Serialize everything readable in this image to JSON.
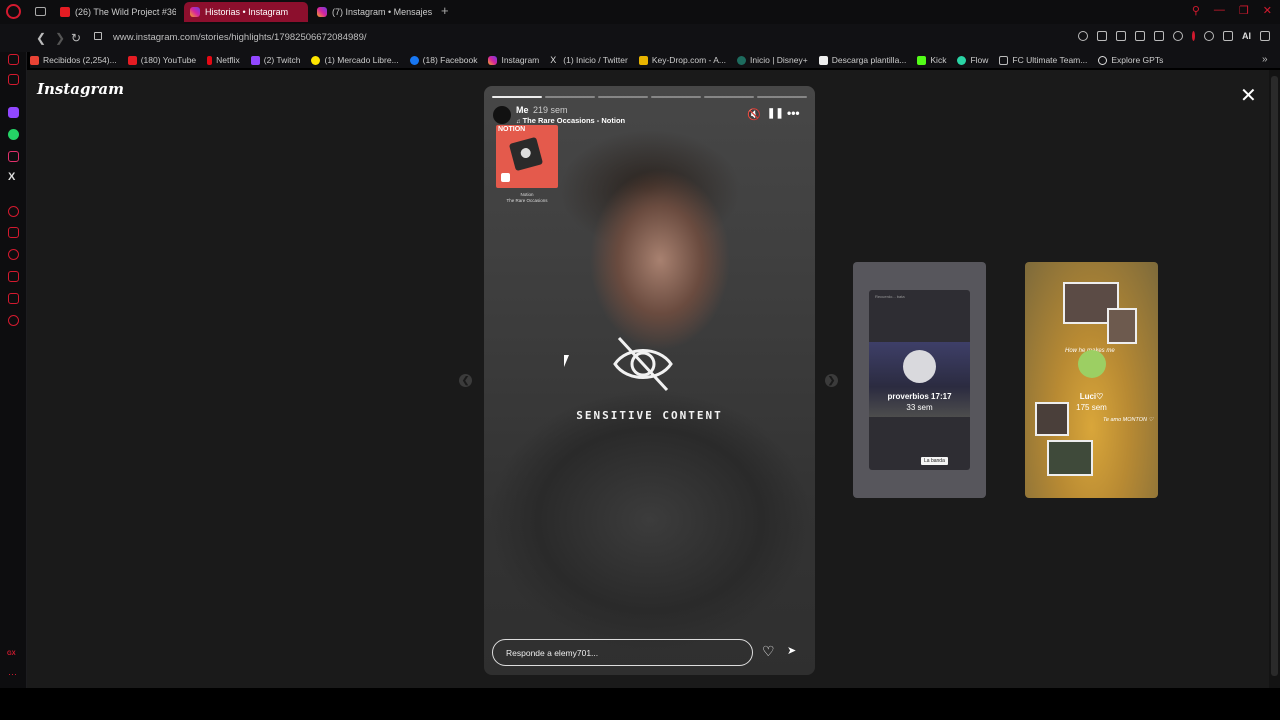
{
  "browser": {
    "tabs": [
      {
        "title": "(26) The Wild Project #36"
      },
      {
        "title": "Historias • Instagram"
      },
      {
        "title": "(7) Instagram • Mensajes"
      }
    ],
    "url": "www.instagram.com/stories/highlights/17982506672084989/",
    "ai_label": "AI",
    "bookmarks": [
      {
        "label": "Recibidos (2,254)..."
      },
      {
        "label": "(180) YouTube"
      },
      {
        "label": "Netflix"
      },
      {
        "label": "(2) Twitch"
      },
      {
        "label": "(1) Mercado Libre..."
      },
      {
        "label": "(18) Facebook"
      },
      {
        "label": "Instagram"
      },
      {
        "label": "(1) Inicio / Twitter"
      },
      {
        "label": "Key-Drop.com - A..."
      },
      {
        "label": "Inicio | Disney+"
      },
      {
        "label": "Descarga plantilla..."
      },
      {
        "label": "Kick"
      },
      {
        "label": "Flow"
      },
      {
        "label": "FC Ultimate Team..."
      },
      {
        "label": "Explore GPTs"
      }
    ],
    "sidebar_x": "X",
    "sidebar_footer": "GX"
  },
  "instagram": {
    "logo": "Instagram",
    "story": {
      "username": "Me",
      "time": "219 sem",
      "music": "The Rare Occasions - Notion",
      "music_card_tag": "NOTION",
      "music_song": "Notion",
      "music_artist": "The Rare Occasions",
      "sensitive_label": "SENSITIVE  CONTENT",
      "reply_placeholder": "Responde a elemy701...",
      "progress": {
        "total": 6,
        "completed": 1
      }
    },
    "previews": [
      {
        "title": "proverbios 17:17",
        "time": "33 sem",
        "badge": "La banda",
        "header": "Recuerdo... bata"
      },
      {
        "title": "Luci♡",
        "time": "175 sem",
        "caption": "How he makes me",
        "caption2": "Te amo MONTON ♡"
      }
    ]
  }
}
